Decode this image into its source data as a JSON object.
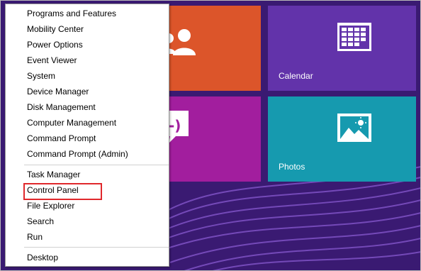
{
  "context_menu": {
    "items": [
      {
        "label": "Programs and Features"
      },
      {
        "label": "Mobility Center"
      },
      {
        "label": "Power Options"
      },
      {
        "label": "Event Viewer"
      },
      {
        "label": "System"
      },
      {
        "label": "Device Manager"
      },
      {
        "label": "Disk Management"
      },
      {
        "label": "Computer Management"
      },
      {
        "label": "Command Prompt"
      },
      {
        "label": "Command Prompt (Admin)"
      },
      {
        "label": "Task Manager"
      },
      {
        "label": "Control Panel"
      },
      {
        "label": "File Explorer"
      },
      {
        "label": "Search"
      },
      {
        "label": "Run"
      },
      {
        "label": "Desktop"
      }
    ]
  },
  "tiles": {
    "calendar": {
      "label": "Calendar",
      "icon": "calendar-icon",
      "color": "#6233aa"
    },
    "photos": {
      "label": "Photos",
      "icon": "photos-icon",
      "color": "#169aaf"
    },
    "people": {
      "label": "",
      "icon": "people-icon",
      "color": "#dc552a"
    },
    "messaging": {
      "label": "",
      "icon": "messaging-icon",
      "color": "#a21e9e"
    }
  },
  "highlight": {
    "target": "Control Panel",
    "color": "#e0282c"
  },
  "colors": {
    "start_background": "#3a1a72"
  }
}
